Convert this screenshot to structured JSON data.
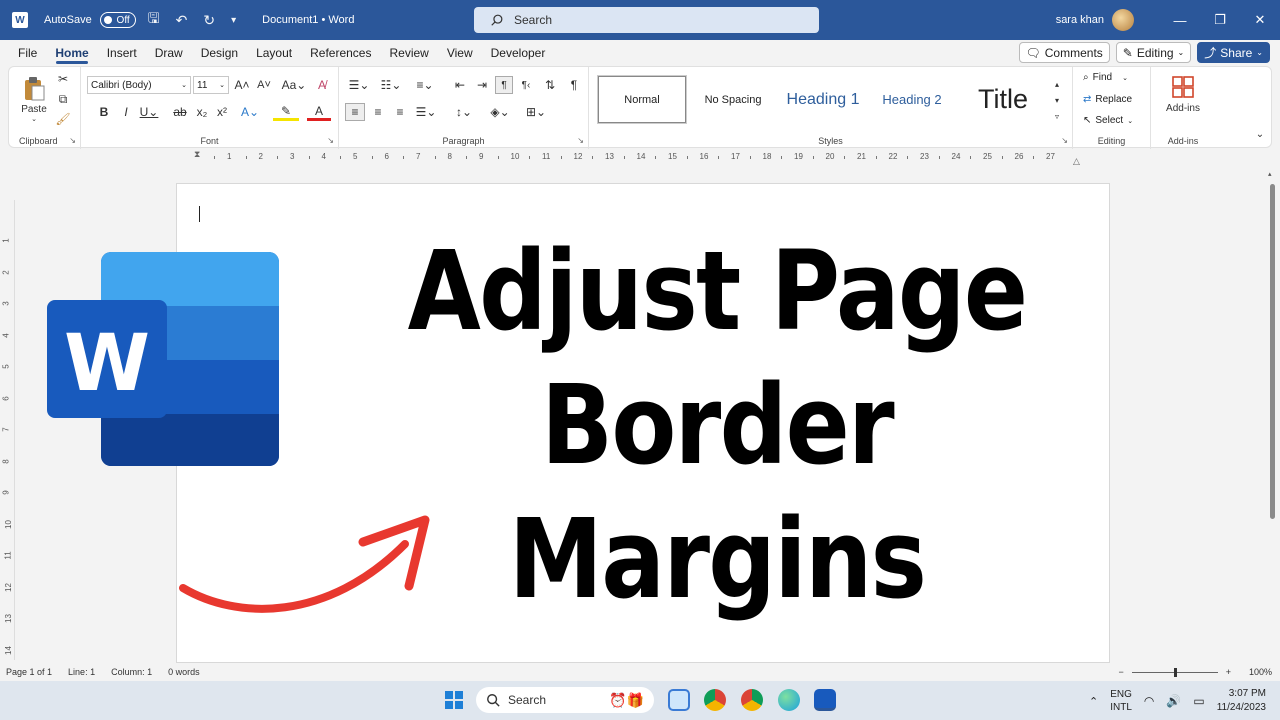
{
  "titlebar": {
    "autosave_label": "AutoSave",
    "autosave_state": "Off",
    "doc_title": "Document1 • Word",
    "search_placeholder": "Search",
    "user_name": "sara khan"
  },
  "menu": {
    "tabs": [
      "File",
      "Home",
      "Insert",
      "Draw",
      "Design",
      "Layout",
      "References",
      "Review",
      "View",
      "Developer"
    ],
    "active_tab": "Home",
    "comments_label": "Comments",
    "editing_label": "Editing",
    "share_label": "Share"
  },
  "ribbon": {
    "clipboard": {
      "label": "Clipboard",
      "paste_label": "Paste"
    },
    "font": {
      "label": "Font",
      "font_name": "Calibri (Body)",
      "font_size": "11"
    },
    "paragraph": {
      "label": "Paragraph"
    },
    "styles": {
      "label": "Styles",
      "items": [
        "Normal",
        "No Spacing",
        "Heading 1",
        "Heading 2",
        "Title"
      ]
    },
    "editing": {
      "label": "Editing",
      "find": "Find",
      "replace": "Replace",
      "select": "Select"
    },
    "addins": {
      "label": "Add-ins",
      "button": "Add-ins"
    }
  },
  "ruler_numbers": [
    "1",
    "2",
    "3",
    "4",
    "5",
    "6",
    "7",
    "8",
    "9",
    "10",
    "11",
    "12",
    "13",
    "14",
    "15",
    "16",
    "17",
    "18",
    "19",
    "20",
    "21",
    "22",
    "23",
    "24",
    "25",
    "26",
    "27"
  ],
  "vruler_numbers": [
    "1",
    "2",
    "3",
    "4",
    "5",
    "6",
    "7",
    "8",
    "9",
    "10",
    "11",
    "12",
    "13",
    "14"
  ],
  "document": {
    "headline_line1": "Adjust Page",
    "headline_line2": "Border Margins"
  },
  "statusbar": {
    "page": "Page 1 of 1",
    "line": "Line: 1",
    "column": "Column: 1",
    "words": "0 words",
    "zoom": "100%"
  },
  "taskbar": {
    "search_label": "Search",
    "lang_top": "ENG",
    "lang_bottom": "INTL",
    "time": "3:07 PM",
    "date": "11/24/2023"
  },
  "colors": {
    "word_blue": "#2b579a",
    "arrow_red": "#e8382f"
  }
}
